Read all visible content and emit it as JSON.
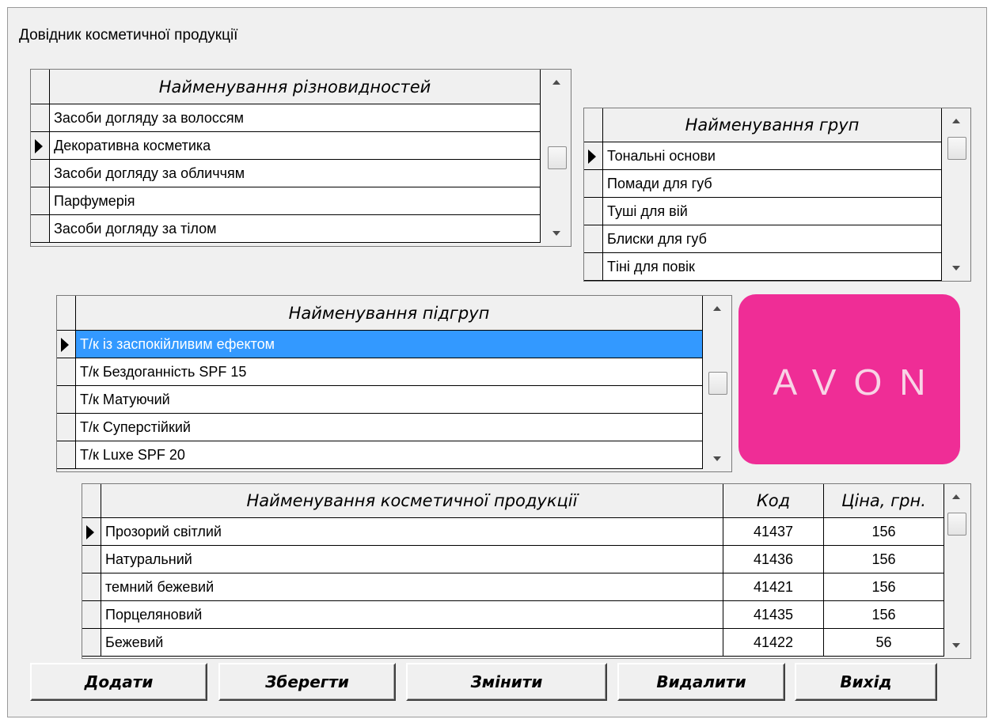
{
  "window": {
    "title": "Довідник косметичної продукції"
  },
  "varieties": {
    "header": "Найменування  різновидностей",
    "rows": [
      "Засоби догляду за волоссям",
      "Декоративна косметика",
      "Засоби догляду за обличчям",
      "Парфумерія",
      "Засоби догляду за тілом"
    ],
    "current_row": 1
  },
  "groups": {
    "header": "Найменування груп",
    "rows": [
      "Тональні основи",
      "Помади для губ",
      "Туші для вій",
      "Блиски для губ",
      "Тіні для повік"
    ],
    "current_row": 0
  },
  "subgroups": {
    "header": "Найменування підгруп",
    "rows": [
      "Т/к із заспокійливим ефектом",
      "Т/к Бездоганність SPF 15",
      "Т/к Матуючий",
      "Т/к Суперстійкий",
      "Т/к Luxe SPF 20"
    ],
    "current_row": 0,
    "selected_row": 0
  },
  "logo": {
    "text": "AVON",
    "bg_color": "#ef2d96"
  },
  "products": {
    "headers": {
      "name": "Найменування косметичної продукції",
      "code": "Код",
      "price": "Ціна, грн."
    },
    "rows": [
      {
        "name": "Прозорий світлий",
        "code": "41437",
        "price": "156"
      },
      {
        "name": "Натуральний",
        "code": "41436",
        "price": "156"
      },
      {
        "name": "темний бежевий",
        "code": "41421",
        "price": "156"
      },
      {
        "name": "Порцеляновий",
        "code": "41435",
        "price": "156"
      },
      {
        "name": "Бежевий",
        "code": "41422",
        "price": "56"
      }
    ],
    "current_row": 0
  },
  "buttons": {
    "add": "Додати",
    "save": "Зберегти",
    "edit": "Змінити",
    "delete": "Видалити",
    "exit": "Вихід"
  },
  "icons": {
    "row_pointer": "row-pointer-icon",
    "scroll_up": "scroll-up-icon",
    "scroll_down": "scroll-down-icon"
  }
}
